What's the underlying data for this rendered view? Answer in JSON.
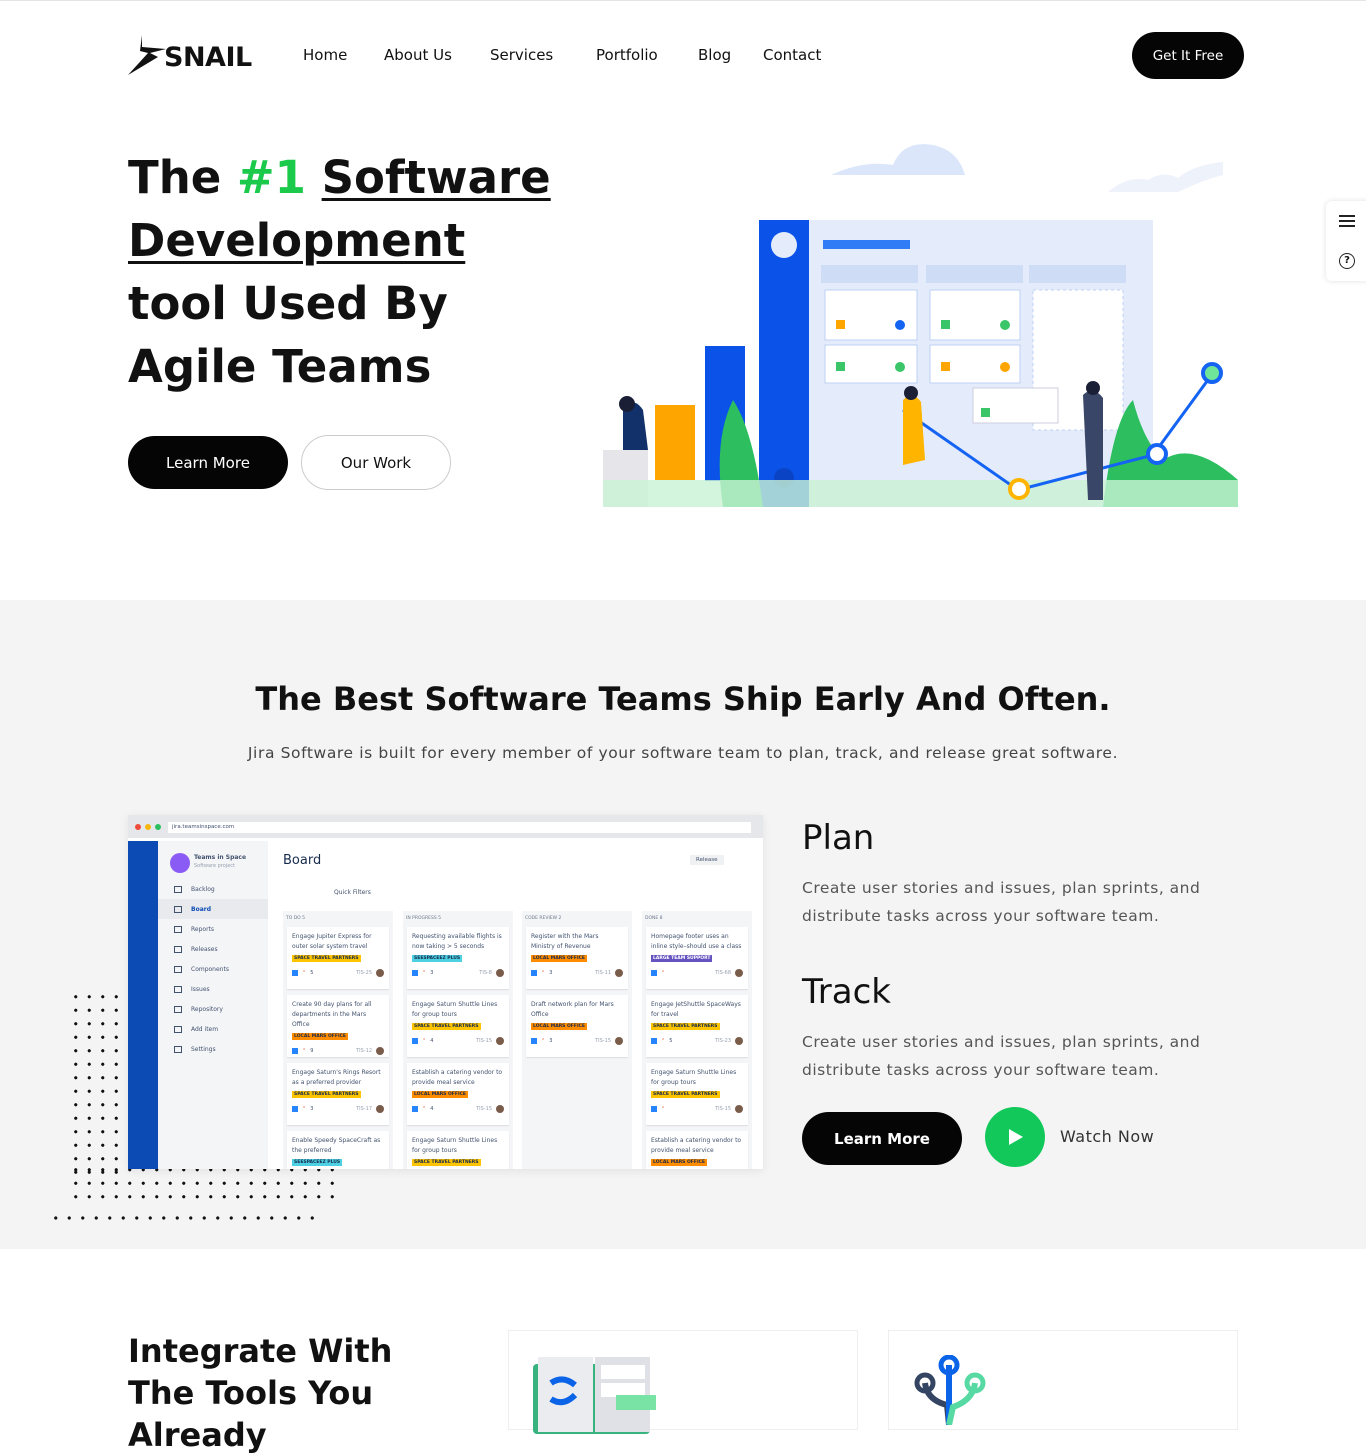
{
  "header": {
    "logo": "SNAIL",
    "nav": [
      "Home",
      "About Us",
      "Services",
      "Portfolio",
      "Blog",
      "Contact"
    ],
    "cta": "Get It Free"
  },
  "hero": {
    "title_part1": "The ",
    "title_highlight": "#1",
    "title_underlined": "Software Development",
    "title_part2": " tool Used By Agile Teams",
    "learn_more": "Learn More",
    "our_work": "Our Work"
  },
  "side_widget": {
    "icons": [
      "sliders-icon",
      "help-icon"
    ]
  },
  "section2": {
    "title": "The Best Software Teams Ship Early And Often.",
    "subtitle": "Jira Software is built for every member of your software team to plan, track, and release great software.",
    "plan_title": "Plan",
    "plan_text": "Create user stories and issues, plan sprints, and distribute tasks across your software team.",
    "track_title": "Track",
    "track_text": "Create user stories and issues, plan sprints, and distribute tasks across your software team.",
    "learn_more": "Learn More",
    "watch_now": "Watch Now"
  },
  "jira": {
    "url": "jira.teamsinspace.com",
    "project": "Teams in Space",
    "project_type": "Software project",
    "board_title": "Board",
    "quick_filters": "Quick Filters",
    "release": "Release",
    "sidebar": [
      "Backlog",
      "Board",
      "Reports",
      "Releases",
      "Components",
      "Issues",
      "Repository",
      "Add item",
      "Settings"
    ],
    "columns": [
      {
        "title": "TO DO 5",
        "cards": [
          {
            "text": "Engage Jupiter Express for outer solar system travel",
            "label": "SPACE TRAVEL PARTNERS",
            "count": "5",
            "key": "TIS-25"
          },
          {
            "text": "Create 90 day plans for all departments in the Mars Office",
            "label": "LOCAL MARS OFFICE",
            "count": "9",
            "key": "TIS-12"
          },
          {
            "text": "Engage Saturn's Rings Resort as a preferred provider",
            "label": "SPACE TRAVEL PARTNERS",
            "count": "3",
            "key": "TIS-17"
          },
          {
            "text": "Enable Speedy SpaceCraft as the preferred",
            "label": "SEESPACEEZ PLUS",
            "count": "",
            "key": ""
          }
        ]
      },
      {
        "title": "IN PROGRESS 5",
        "cards": [
          {
            "text": "Requesting available flights is now taking > 5 seconds",
            "label": "SEESPACEEZ PLUS",
            "count": "3",
            "key": "TIS-8"
          },
          {
            "text": "Engage Saturn Shuttle Lines for group tours",
            "label": "SPACE TRAVEL PARTNERS",
            "count": "4",
            "key": "TIS-15"
          },
          {
            "text": "Establish a catering vendor to provide meal service",
            "label": "LOCAL MARS OFFICE",
            "count": "4",
            "key": "TIS-15"
          },
          {
            "text": "Engage Saturn Shuttle Lines for group tours",
            "label": "SPACE TRAVEL PARTNERS",
            "count": "",
            "key": ""
          }
        ]
      },
      {
        "title": "CODE REVIEW 2",
        "cards": [
          {
            "text": "Register with the Mars Ministry of Revenue",
            "label": "LOCAL MARS OFFICE",
            "count": "3",
            "key": "TIS-11"
          },
          {
            "text": "Draft network plan for Mars Office",
            "label": "LOCAL MARS OFFICE",
            "count": "3",
            "key": "TIS-15"
          }
        ]
      },
      {
        "title": "DONE 8",
        "cards": [
          {
            "text": "Homepage footer uses an inline style–should use a class",
            "label": "LARGE TEAM SUPPORT",
            "count": "",
            "key": "TIS-68"
          },
          {
            "text": "Engage JetShuttle SpaceWays for travel",
            "label": "SPACE TRAVEL PARTNERS",
            "count": "5",
            "key": "TIS-23"
          },
          {
            "text": "Engage Saturn Shuttle Lines for group tours",
            "label": "SPACE TRAVEL PARTNERS",
            "count": "",
            "key": "TIS-15"
          },
          {
            "text": "Establish a catering vendor to provide meal service",
            "label": "LOCAL MARS OFFICE",
            "count": "",
            "key": ""
          }
        ]
      }
    ],
    "label_colors": {
      "SPACE TRAVEL PARTNERS": "#ffc400",
      "LOCAL MARS OFFICE": "#ff8b00",
      "SEESPACEEZ PLUS": "#4dd0e1",
      "LARGE TEAM SUPPORT": "#6554c0"
    }
  },
  "section3": {
    "title": "Integrate With The Tools You Already"
  },
  "colors": {
    "accent_green": "#1bc94b",
    "play_green": "#12c85a",
    "black": "#050505",
    "jira_blue": "#0b4bb3"
  }
}
